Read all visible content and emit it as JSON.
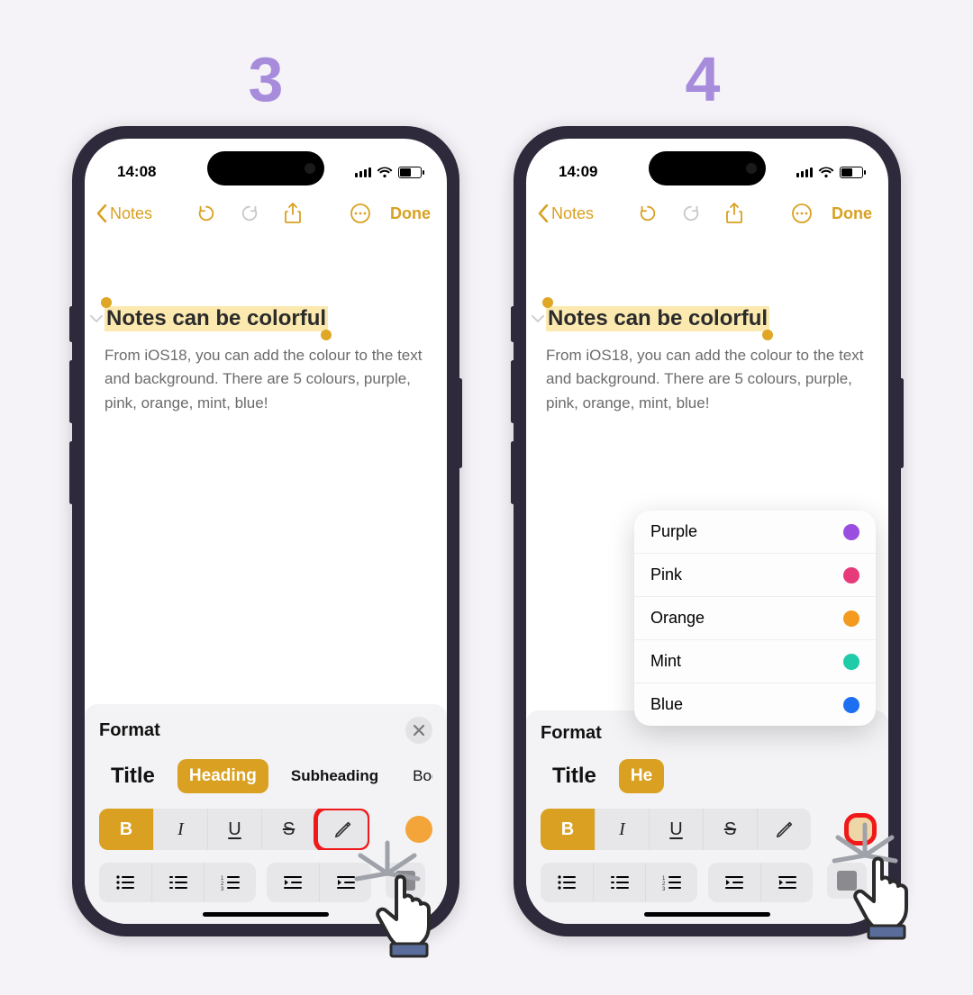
{
  "steps": {
    "left": "3",
    "right": "4"
  },
  "status": {
    "left_time": "14:08",
    "right_time": "14:09"
  },
  "nav": {
    "back": "Notes",
    "done": "Done"
  },
  "note": {
    "title": "Notes can be colorful",
    "body": "From iOS18, you can add the colour to the text and background. There are 5 colours, purple, pink, orange, mint, blue!"
  },
  "format": {
    "heading": "Format",
    "styles": [
      "Title",
      "Heading",
      "Subheading",
      "Body"
    ],
    "buttons": {
      "bold": "B",
      "italic": "I",
      "underline": "U",
      "strike": "S"
    }
  },
  "right_styles": [
    "Title",
    "He"
  ],
  "colors": {
    "swatch": "#f3a53a",
    "swatch_right": "#efd6a7",
    "menu": [
      {
        "label": "Purple",
        "color": "#9b4de0"
      },
      {
        "label": "Pink",
        "color": "#e63a7a"
      },
      {
        "label": "Orange",
        "color": "#f39a1f"
      },
      {
        "label": "Mint",
        "color": "#1fcba8"
      },
      {
        "label": "Blue",
        "color": "#1d6ff2"
      }
    ]
  }
}
